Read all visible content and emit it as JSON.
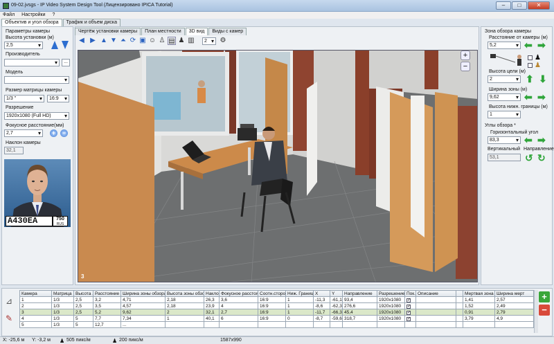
{
  "window": {
    "title": "09-02.jvsgs - IP Video System Design Tool (Лицензировано  IPICA Tutorial)",
    "minimize": "–",
    "maximize": "□",
    "close": "✕"
  },
  "menu": [
    "Файл",
    "Настройки",
    "?"
  ],
  "main_tabs": [
    "Объектив и угол обзора",
    "Трафик и объем диска"
  ],
  "left": {
    "group": "Параметры камеры",
    "height_label": "Высота установки (м)",
    "height_value": "2,5",
    "vendor_label": "Производитель",
    "vendor_value": "",
    "vendor_btn": "...",
    "model_label": "Модель",
    "model_value": "",
    "matrix_label": "Размер матрицы камеры",
    "matrix_value": "1/3 \"",
    "ratio_value": "16:9",
    "resolution_label": "Разрешение",
    "resolution_value": "1920x1080 (Full HD)",
    "focal_label": "Фокусное расстояние(мм)",
    "focal_value": "2,7",
    "tilt_label": "Наклон камеры",
    "tilt_value": "32,1",
    "plate_text": "A430EA",
    "plate_region": "750",
    "plate_country": "RUS"
  },
  "view_tabs": [
    "Чертёж установки камеры",
    "План местности",
    "3D вид",
    "Виды с камер"
  ],
  "toolbar": {
    "count": "2"
  },
  "scene": {
    "camera_num": "3",
    "zoom_in": "+",
    "zoom_out": "−"
  },
  "right": {
    "group": "Зона обзора камеры",
    "distance_label": "Расстояние от камеры (м)",
    "distance_value": "5,2",
    "target_h_label": "Высота цели (м)",
    "target_h_value": "2",
    "width_label": "Ширина зоны (м)",
    "width_value": "9,62",
    "lower_label": "Высота нижн. границы (м)",
    "lower_value": "1",
    "angles_label": "Углы обзора *",
    "hangle_label": "Горизонтальный угол",
    "hangle_value": "83,3",
    "vangle_label": "Вертикальный",
    "vangle_value": "53,1",
    "direction_label": "Направление"
  },
  "table": {
    "headers": [
      "Камера",
      "Матрица",
      "Высота ...",
      "Расстояние",
      "Ширина зоны обзора",
      "Высота зоны обзора",
      "Наклон",
      "Фокусное расстояние",
      "Соотн.сторон",
      "Ниж. Граница",
      "X",
      "Y",
      "Направление",
      "Разрешение",
      "Пок...",
      "Описание",
      "",
      "Мертвая зона",
      "Ширина мерт"
    ],
    "rows": [
      [
        "1",
        "1/3",
        "2,5",
        "3,2",
        "4,71",
        "2,18",
        "26,3",
        "3,6",
        "16:9",
        "1",
        "-11,3",
        "-61,1",
        "93,4",
        "1920x1080",
        "✓",
        "",
        "",
        "1,41",
        "2,57"
      ],
      [
        "2",
        "1/3",
        "2,5",
        "3,5",
        "4,57",
        "2,18",
        "23,9",
        "4",
        "16:9",
        "1",
        "-8,6",
        "-62,3",
        "276,6",
        "1920x1080",
        "✓",
        "",
        "",
        "1,52",
        "2,49"
      ],
      [
        "3",
        "1/3",
        "2,5",
        "5,2",
        "9,62",
        "2",
        "32,1",
        "2,7",
        "16:9",
        "1",
        "-11,7",
        "-66,3",
        "45,4",
        "1920x1080",
        "✓",
        "",
        "",
        "0,91",
        "2,79"
      ],
      [
        "4",
        "1/3",
        "5",
        "7,7",
        "7,34",
        "1",
        "40,1",
        "6",
        "16:9",
        "0",
        "-8,7",
        "-59,6",
        "318,7",
        "1920x1080",
        "✓",
        "",
        "",
        "3,79",
        "4,9"
      ],
      [
        "5",
        "1/3",
        "5",
        "12,7",
        "...",
        "",
        "",
        "",
        "",
        "",
        "",
        "",
        "",
        "",
        "",
        "",
        "",
        "",
        ""
      ]
    ]
  },
  "status": {
    "x": "X: -25,6 м",
    "y": "Y: -3,2 м",
    "ppm1": "505 пикс/м",
    "ppm2": "200 пикс/м",
    "res": "1587x990"
  }
}
